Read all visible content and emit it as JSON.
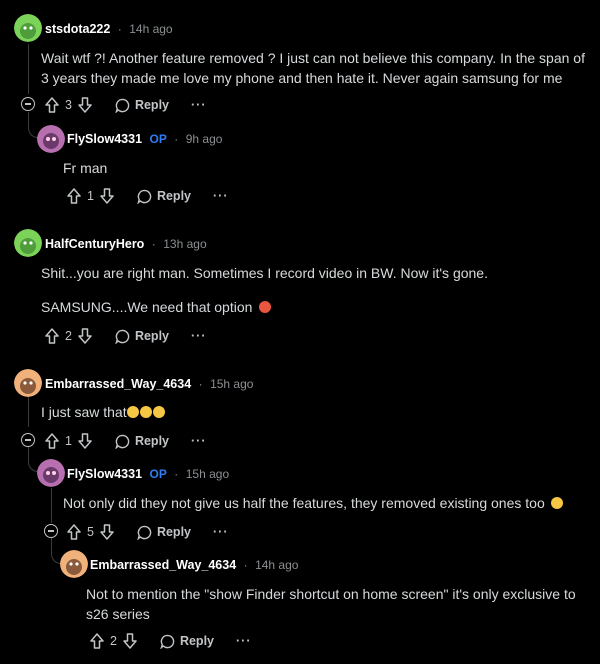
{
  "comments": [
    {
      "username": "stsdota222",
      "time": "14h ago",
      "body": "Wait wtf ?! Another feature removed ? I just can not believe this company. In the span of 3 years they made me love my phone and then hate it. Never again samsung for me",
      "votes": "3",
      "reply_label": "Reply",
      "more": "···",
      "replies": [
        {
          "username": "FlySlow4331",
          "op_badge": "OP",
          "time": "9h ago",
          "body": "Fr man",
          "votes": "1",
          "reply_label": "Reply",
          "more": "···"
        }
      ]
    },
    {
      "username": "HalfCenturyHero",
      "time": "13h ago",
      "body_line1": "Shit...you are right man. Sometimes I record video in BW. Now it's gone.",
      "body_line2": "SAMSUNG....We need that option",
      "votes": "2",
      "reply_label": "Reply",
      "more": "···"
    },
    {
      "username": "Embarrassed_Way_4634",
      "time": "15h ago",
      "body": "I just saw that",
      "votes": "1",
      "reply_label": "Reply",
      "more": "···",
      "replies": [
        {
          "username": "FlySlow4331",
          "op_badge": "OP",
          "time": "15h ago",
          "body": "Not only did they not give us half the features, they removed existing ones too",
          "votes": "5",
          "reply_label": "Reply",
          "more": "···",
          "replies": [
            {
              "username": "Embarrassed_Way_4634",
              "time": "14h ago",
              "body": "Not to mention the \"show Finder shortcut on home screen\" it's only exclusive to s26 series",
              "votes": "2",
              "reply_label": "Reply",
              "more": "···"
            }
          ]
        }
      ]
    }
  ],
  "meta_separator": "·",
  "colors": {
    "background": "#000000",
    "text": "#d7dadc",
    "meta": "#8b8f92",
    "op_badge": "#2f7cf6",
    "thread_line": "#3a3c3f",
    "avatar_green": "#7bd35a",
    "avatar_peach": "#f0b27a",
    "avatar_purple": "#b86fb0"
  },
  "icons": {
    "upvote": "arrow-up-outline-icon",
    "downvote": "arrow-down-outline-icon",
    "reply": "speech-bubble-icon",
    "more": "ellipsis-icon",
    "collapse": "circle-minus-icon"
  }
}
